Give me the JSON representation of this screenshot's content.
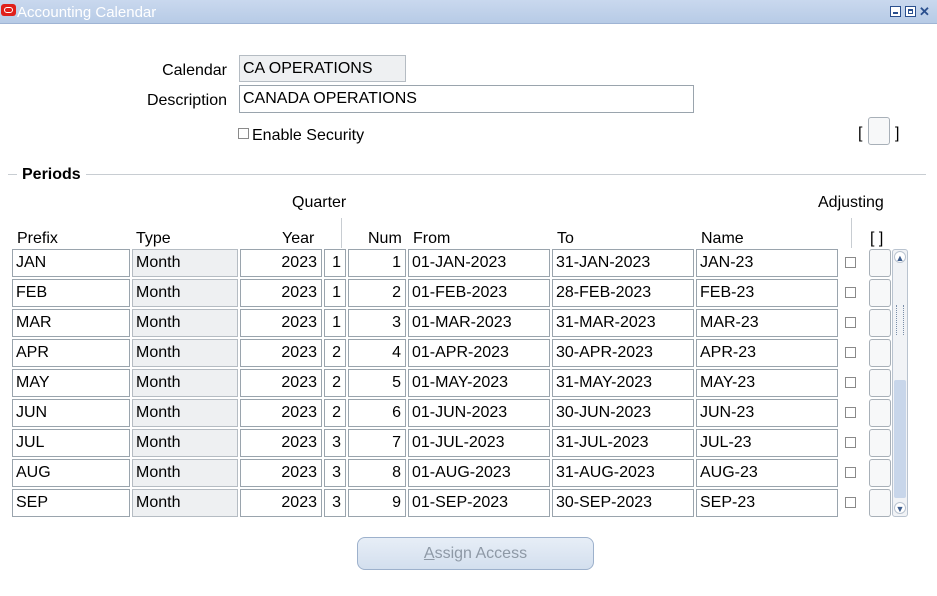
{
  "window": {
    "title": "Accounting Calendar",
    "controls": {
      "minimize": "minimize",
      "maximize": "maximize",
      "close": "✕"
    }
  },
  "header": {
    "calendar_label": "Calendar",
    "calendar_value": "CA OPERATIONS",
    "description_label": "Description",
    "description_value": "CANADA OPERATIONS",
    "enable_security_label": "Enable Security",
    "enable_security_checked": false,
    "dff_open": "[",
    "dff_close": "]"
  },
  "periods": {
    "section_title": "Periods",
    "group_headers": {
      "quarter": "Quarter",
      "adjusting": "Adjusting"
    },
    "columns": {
      "prefix": "Prefix",
      "type": "Type",
      "year": "Year",
      "num": "Num",
      "from": "From",
      "to": "To",
      "name": "Name",
      "dff": "[ ]"
    },
    "rows": [
      {
        "prefix": "JAN",
        "type": "Month",
        "year": "2023",
        "quarter": "1",
        "num": "1",
        "from": "01-JAN-2023",
        "to": "31-JAN-2023",
        "name": "JAN-23",
        "adjusting": false
      },
      {
        "prefix": "FEB",
        "type": "Month",
        "year": "2023",
        "quarter": "1",
        "num": "2",
        "from": "01-FEB-2023",
        "to": "28-FEB-2023",
        "name": "FEB-23",
        "adjusting": false
      },
      {
        "prefix": "MAR",
        "type": "Month",
        "year": "2023",
        "quarter": "1",
        "num": "3",
        "from": "01-MAR-2023",
        "to": "31-MAR-2023",
        "name": "MAR-23",
        "adjusting": false
      },
      {
        "prefix": "APR",
        "type": "Month",
        "year": "2023",
        "quarter": "2",
        "num": "4",
        "from": "01-APR-2023",
        "to": "30-APR-2023",
        "name": "APR-23",
        "adjusting": false
      },
      {
        "prefix": "MAY",
        "type": "Month",
        "year": "2023",
        "quarter": "2",
        "num": "5",
        "from": "01-MAY-2023",
        "to": "31-MAY-2023",
        "name": "MAY-23",
        "adjusting": false
      },
      {
        "prefix": "JUN",
        "type": "Month",
        "year": "2023",
        "quarter": "2",
        "num": "6",
        "from": "01-JUN-2023",
        "to": "30-JUN-2023",
        "name": "JUN-23",
        "adjusting": false
      },
      {
        "prefix": "JUL",
        "type": "Month",
        "year": "2023",
        "quarter": "3",
        "num": "7",
        "from": "01-JUL-2023",
        "to": "31-JUL-2023",
        "name": "JUL-23",
        "adjusting": false
      },
      {
        "prefix": "AUG",
        "type": "Month",
        "year": "2023",
        "quarter": "3",
        "num": "8",
        "from": "01-AUG-2023",
        "to": "31-AUG-2023",
        "name": "AUG-23",
        "adjusting": false
      },
      {
        "prefix": "SEP",
        "type": "Month",
        "year": "2023",
        "quarter": "3",
        "num": "9",
        "from": "01-SEP-2023",
        "to": "30-SEP-2023",
        "name": "SEP-23",
        "adjusting": false
      }
    ]
  },
  "footer": {
    "assign_access_mnemonic": "A",
    "assign_access_rest": "ssign Access"
  },
  "colors": {
    "titlebar": "#b7cbe6",
    "readonly_field": "#eef0f2",
    "button_text_disabled": "#8e99a6"
  }
}
